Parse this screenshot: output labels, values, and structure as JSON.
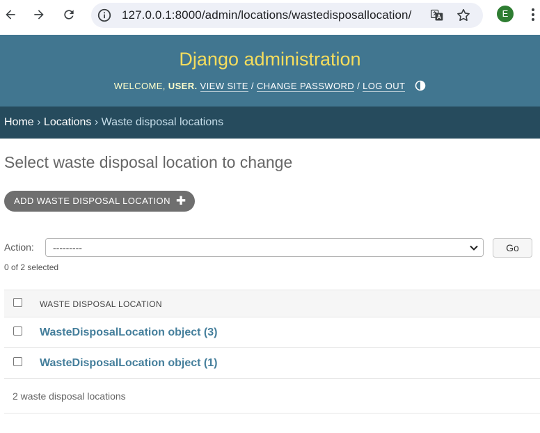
{
  "browser": {
    "url": "127.0.0.1:8000/admin/locations/wastedisposallocation/",
    "avatar_letter": "E",
    "icons": [
      "back-arrow-icon",
      "forward-arrow-icon",
      "reload-icon",
      "site-info-icon",
      "translate-icon",
      "bookmark-star-icon",
      "kebab-menu-icon"
    ]
  },
  "header": {
    "site_name": "Django administration",
    "welcome": "WELCOME,",
    "username": "USER.",
    "view_site": "VIEW SITE",
    "change_password": "CHANGE PASSWORD",
    "log_out": "LOG OUT",
    "separator": "/"
  },
  "breadcrumbs": {
    "home": "Home",
    "app": "Locations",
    "current": "Waste disposal locations",
    "separator": "›"
  },
  "content": {
    "title": "Select waste disposal location to change",
    "add_button": "ADD WASTE DISPOSAL LOCATION",
    "action_label": "Action:",
    "action_value": "---------",
    "go_label": "Go",
    "selection_counter": "0 of 2 selected",
    "column_header": "WASTE DISPOSAL LOCATION",
    "rows": [
      {
        "label": "WasteDisposalLocation object (3)"
      },
      {
        "label": "WasteDisposalLocation object (1)"
      }
    ],
    "paginator": "2 waste disposal locations"
  },
  "colors": {
    "header_bg": "#417690",
    "branding": "#f5dd5d",
    "breadcrumb_bg": "#264b5d",
    "link": "#447e9b",
    "add_button_bg": "#6f6f6f"
  }
}
